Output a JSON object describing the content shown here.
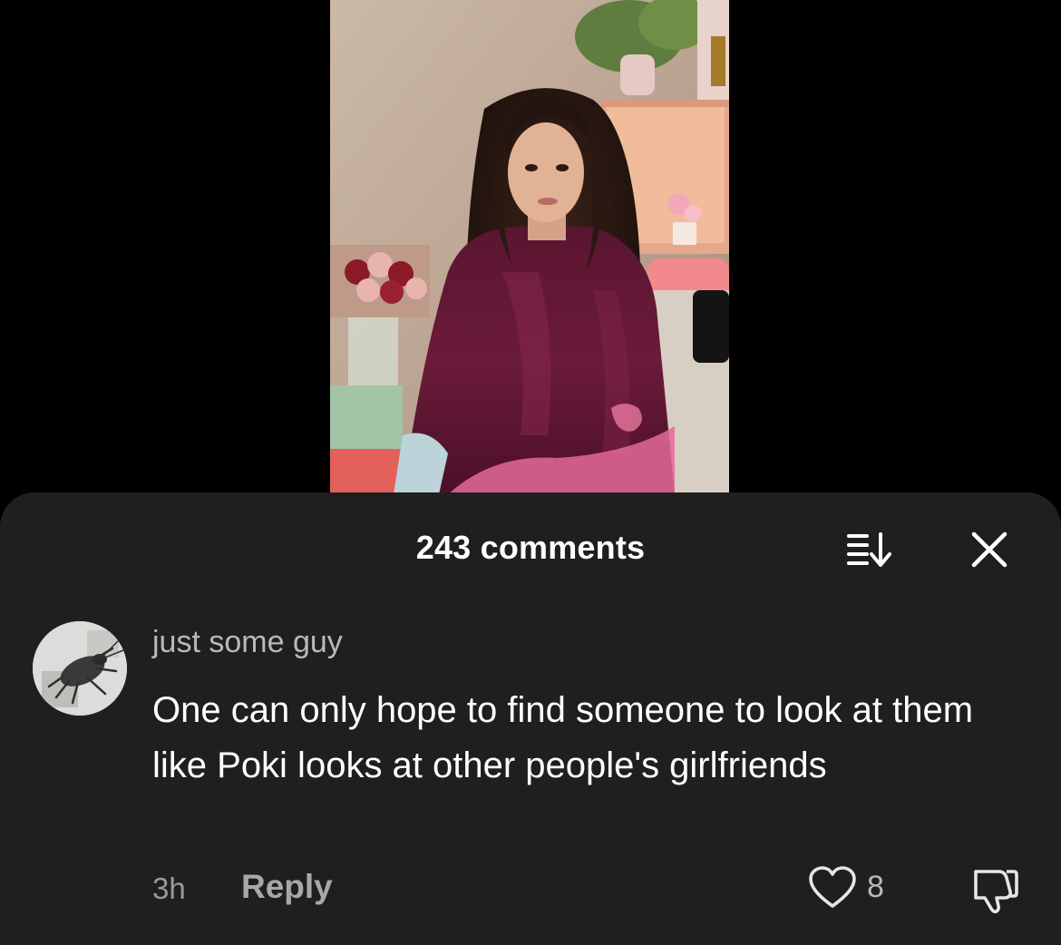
{
  "video": {
    "thumbnail": "woman-in-burgundy-satin-robe"
  },
  "comments_panel": {
    "count_label": "243 comments",
    "sort_icon": "sort-icon",
    "close_icon": "close-icon"
  },
  "comment": {
    "avatar": "avatar-image",
    "username": "just some guy",
    "text": "One can only hope to find someone to look at them like Poki looks at other people's girlfriends",
    "timestamp": "3h",
    "reply_label": "Reply",
    "like_count": "8",
    "like_icon": "heart-icon",
    "dislike_icon": "thumbs-down-icon"
  },
  "colors": {
    "background": "#000000",
    "sheet": "#1f1f1f",
    "primary_text": "#ffffff",
    "secondary_text": "#b9b9b9"
  }
}
